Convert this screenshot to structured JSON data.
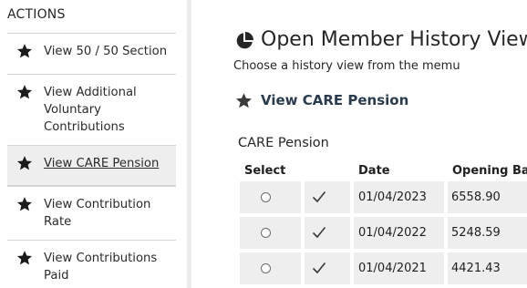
{
  "sidebar": {
    "heading": "ACTIONS",
    "items": [
      {
        "label": "View 50 / 50 Section",
        "icon": "star-icon",
        "active": false
      },
      {
        "label": "View Additional Voluntary Contributions",
        "icon": "star-icon",
        "active": false
      },
      {
        "label": "View CARE Pension",
        "icon": "star-icon",
        "active": true
      },
      {
        "label": "View Contribution Rate",
        "icon": "star-icon",
        "active": false
      },
      {
        "label": "View Contributions Paid",
        "icon": "star-icon",
        "active": false
      }
    ]
  },
  "main": {
    "title": "Open Member History View",
    "title_icon": "pie-chart-icon",
    "subtitle": "Choose a history view from the memu",
    "section_link": {
      "label": "View CARE Pension",
      "icon": "star-icon"
    },
    "table": {
      "caption": "CARE Pension",
      "columns": [
        "Select",
        "",
        "Date",
        "Opening Bala"
      ],
      "rows": [
        {
          "selected": false,
          "checked": true,
          "date": "01/04/2023",
          "opening_balance": "6558.90"
        },
        {
          "selected": false,
          "checked": true,
          "date": "01/04/2022",
          "opening_balance": "5248.59"
        },
        {
          "selected": false,
          "checked": true,
          "date": "01/04/2021",
          "opening_balance": "4421.43"
        }
      ]
    }
  },
  "colors": {
    "sidebar_active_bg": "#eeeeee",
    "cell_bg": "#eeeeee",
    "section_link": "#2a3b4d",
    "divider": "#d5d5d5"
  }
}
